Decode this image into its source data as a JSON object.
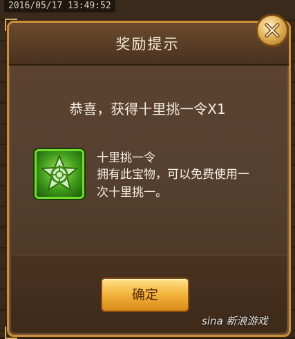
{
  "timestamp": "2016/05/17 13:49:52",
  "dialog": {
    "title": "奖励提示",
    "close_icon": "close-icon",
    "message": "恭喜，获得十里挑一令X1",
    "item": {
      "icon": "star-badge-icon",
      "name": "十里挑一令",
      "description": "拥有此宝物，可以免费使用一次十里挑一。"
    },
    "confirm_label": "确定"
  },
  "watermark": "sina 新浪游戏",
  "colors": {
    "accent_gold": "#e4b45a",
    "item_border_green": "#6edb2e",
    "panel_brown": "#5a3e28"
  }
}
